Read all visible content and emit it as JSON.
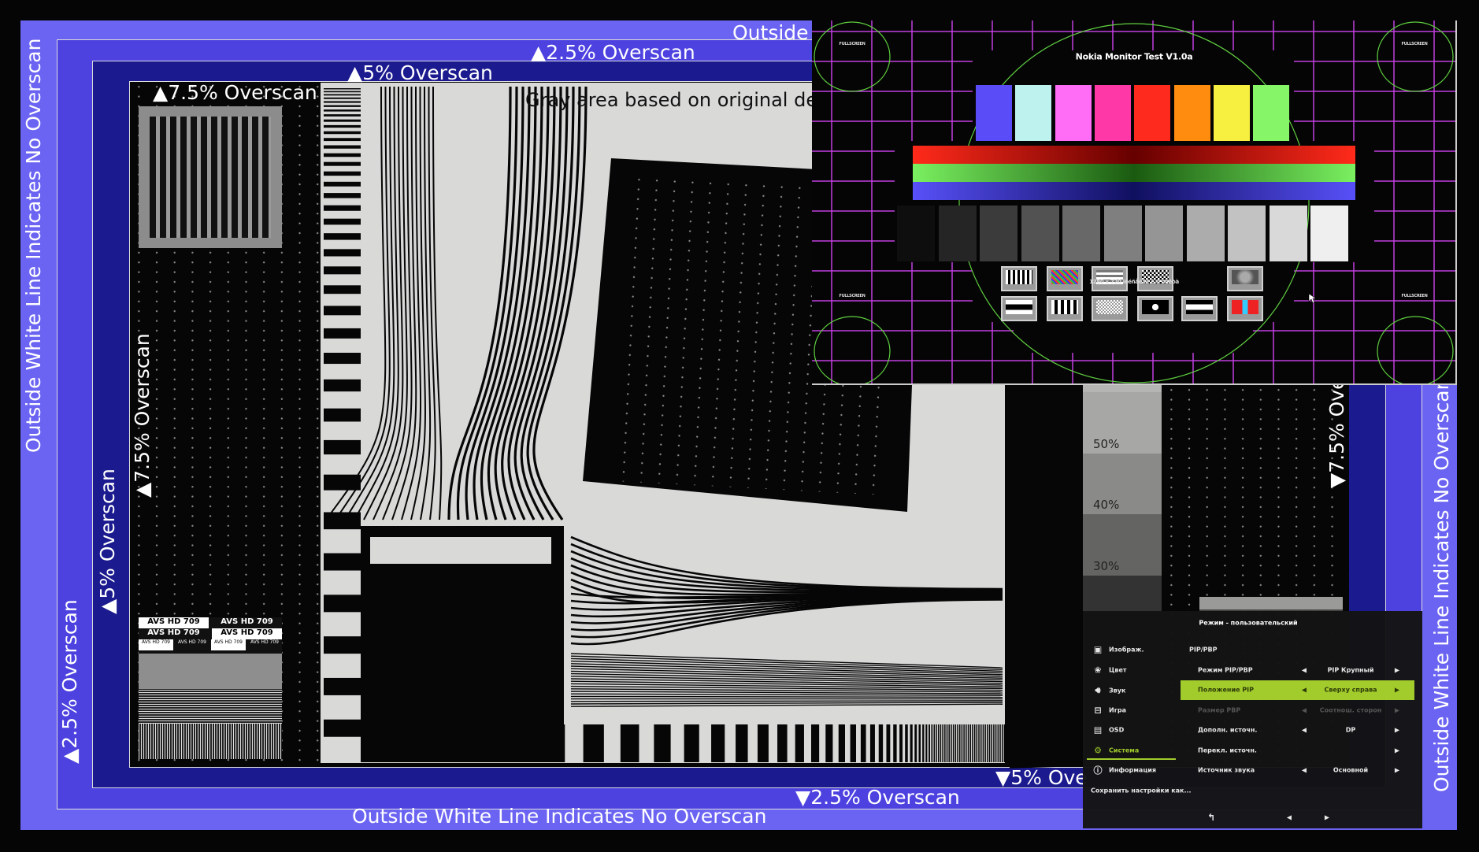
{
  "overscan_labels": {
    "outside_top": "Outside White Line Indicates No Overscan",
    "outside_left": "Outside White Line Indicates No Overscan",
    "outside_right": "Outside White Line Indicates No Overscan",
    "outside_bottom": "Outside White Line Indicates No Overscan",
    "top_2_5": "▲2.5% Overscan",
    "top_5": "▲5% Overscan",
    "top_7_5": "▲7.5% Overscan",
    "left_2_5": "▲2.5% Overscan",
    "left_5": "▲5% Overscan",
    "left_7_5": "▲7.5% Overscan",
    "right_7_5": "▼7.5% Ove",
    "bottom_2_5": "▼2.5% Overscan",
    "bottom_5": "▼5% Ove"
  },
  "gray_area_note": "Gray area based on original des",
  "avs_label": "AVS HD 709",
  "gray_steps": [
    "50%",
    "40%",
    "30%"
  ],
  "colors": {
    "band_outer": "#6b64f2",
    "band_2_5": "#4d42e0",
    "band_5": "#1b1a8e",
    "osd_accent": "#a2cc2c",
    "pip_grid": "#c23ee0",
    "pip_circle": "#5fd040"
  },
  "pip": {
    "title": "Nokia Monitor Test V1.0a",
    "resolution_text": "1280 x 720 ièéñåëåé è 0 òàêòà",
    "corner_label": "FULLSCREEN",
    "color_bars": [
      "#5a4cf6",
      "#bdf2ee",
      "#ff6cf6",
      "#ff38a8",
      "#ff2a1e",
      "#ff8c0e",
      "#f8f040",
      "#86f668"
    ],
    "icons": [
      "grid-pattern-icon",
      "color-diagonal-icon",
      "horizontal-lines-icon",
      "checkerboard-icon",
      "wizard-icon",
      "border-icon",
      "convergence-icon",
      "dot-grid-icon",
      "white-square-icon",
      "white-bar-icon",
      "exit-icon"
    ]
  },
  "osd": {
    "header": "Режим - пользовательский",
    "section_title": "PIP/PBP",
    "menu": [
      {
        "label": "Изображ.",
        "icon": "picture-icon"
      },
      {
        "label": "Цвет",
        "icon": "palette-icon"
      },
      {
        "label": "Звук",
        "icon": "speaker-icon"
      },
      {
        "label": "Игра",
        "icon": "gamepad-icon"
      },
      {
        "label": "OSD",
        "icon": "osd-icon"
      },
      {
        "label": "Система",
        "icon": "gear-icon",
        "active": true
      },
      {
        "label": "Информация",
        "icon": "info-icon"
      }
    ],
    "save_label": "Сохранить настройки как...",
    "rows": [
      {
        "label": "Режим PIP/PBP",
        "value": "PIP Крупный"
      },
      {
        "label": "Положение PIP",
        "value": "Сверху справа",
        "selected": true
      },
      {
        "label": "Размер PBP",
        "value": "Соотнош. сторон",
        "disabled": true
      },
      {
        "label": "Дополн. источн.",
        "value": "DP"
      },
      {
        "label": "Перекл. источн.",
        "value": ""
      },
      {
        "label": "Источник звука",
        "value": "Основной"
      }
    ]
  }
}
